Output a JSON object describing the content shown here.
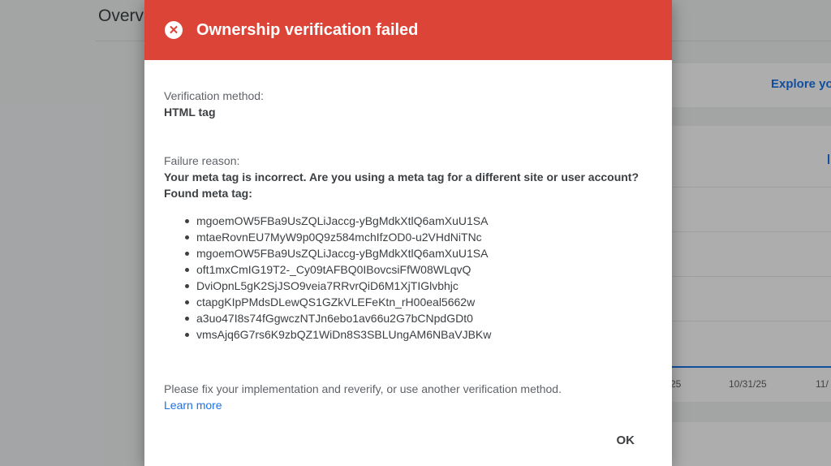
{
  "background": {
    "page_title": "Overv",
    "explore_link": "Explore you",
    "axis_ticks": [
      "25",
      "10/31/25",
      "11/"
    ]
  },
  "dialog": {
    "title": "Ownership verification failed",
    "method_label": "Verification method:",
    "method_value": "HTML tag",
    "failure_label": "Failure reason:",
    "failure_message": "Your meta tag is incorrect. Are you using a meta tag for a different site or user account?",
    "found_label": "Found meta tag:",
    "meta_tags": [
      "mgoemOW5FBa9UsZQLiJaccg-yBgMdkXtlQ6amXuU1SA",
      "mtaeRovnEU7MyW9p0Q9z584mchIfzOD0-u2VHdNiTNc",
      "mgoemOW5FBa9UsZQLiJaccg-yBgMdkXtlQ6amXuU1SA",
      "oft1mxCmIG19T2-_Cy09tAFBQ0IBovcsiFfW08WLqvQ",
      "DviOpnL5gK2SjJSO9veia7RRvrQiD6M1XjTIGlvbhjc",
      "ctapgKIpPMdsDLewQS1GZkVLEFeKtn_rH00eal5662w",
      "a3uo47I8s74fGgwczNTJn6ebo1av66u2G7bCNpdGDt0",
      "vmsAjq6G7rs6K9zbQZ1WiDn8S3SBLUngAM6NBaVJBKw"
    ],
    "help_text": "Please fix your implementation and reverify, or use another verification method.",
    "learn_more": "Learn more",
    "ok_label": "OK"
  },
  "icons": {
    "header_icon": "error-circle-icon"
  },
  "colors": {
    "header_red": "#db4437",
    "link_blue": "#1a73e8"
  }
}
